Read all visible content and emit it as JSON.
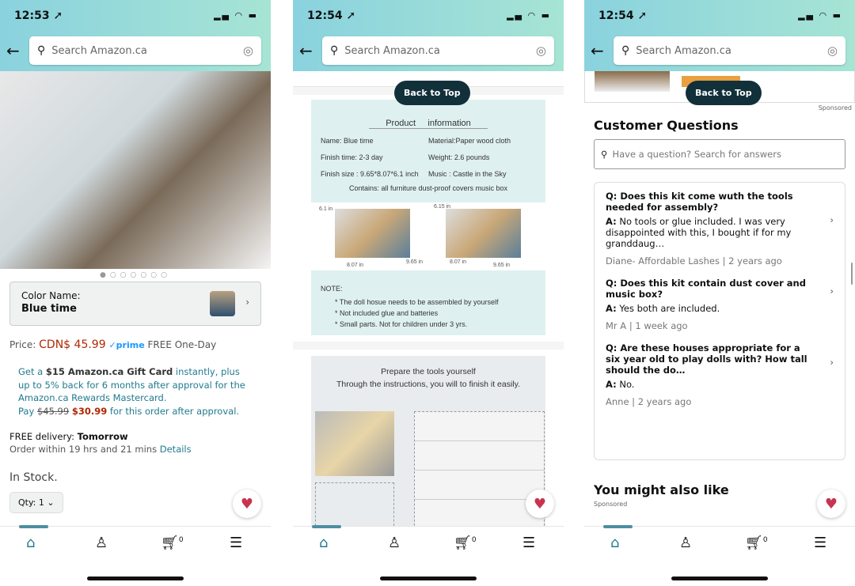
{
  "screens": [
    {
      "time": "12:53 ➚",
      "search_placeholder": "Search Amazon.ca"
    },
    {
      "time": "12:54 ➚",
      "search_placeholder": "Search Amazon.ca"
    },
    {
      "time": "12:54 ➚",
      "search_placeholder": "Search Amazon.ca"
    }
  ],
  "product": {
    "color_label": "Color Name:",
    "color_value": "Blue time",
    "price_label": "Price:",
    "price": "CDN$ 45.99",
    "prime": "✓prime",
    "shipping": "FREE One-Day",
    "offer": {
      "a": "Get a ",
      "b": "$15 Amazon.ca Gift Card",
      "c": " instantly, plus up to 5% back for 6 months after approval for the Amazon.ca Rewards Mastercard.",
      "pay": "Pay ",
      "old": "$45.99",
      "new": "$30.99",
      "tail": " for this order after approval."
    },
    "delivery_label": "FREE delivery: ",
    "delivery_day": "Tomorrow",
    "order_within": "Order within 19 hrs and 21 mins ",
    "details": "Details",
    "stock": "In Stock.",
    "qty": "Qty: 1"
  },
  "back_to_top": "Back to Top",
  "info": {
    "title": "Product     information",
    "rows": [
      [
        "Name: Blue time",
        "Material:Paper  wood  cloth"
      ],
      [
        "Finish time: 2-3 day",
        "Weight: 2.6 pounds"
      ],
      [
        "Finish size : 9.65*8.07*6.1 inch",
        "Music : Castle in the Sky"
      ]
    ],
    "contains": "Contains: all furniture  dust-proof covers  music box",
    "dims": [
      "6.1 in",
      "8.07 in",
      "9.65 in",
      "6.15 in",
      "8.07 in",
      "9.65 in"
    ],
    "note_title": "NOTE:",
    "notes": [
      "*  The doll hosue needs to be assembled by yourself",
      "*  Not included glue and batteries",
      "*  Small parts. Not for children under 3 yrs."
    ],
    "tools_title": "Prepare the tools yourself",
    "tools_sub": "Through the instructions, you will to finish it easily."
  },
  "sponsored": "Sponsored",
  "questions": {
    "heading": "Customer Questions",
    "placeholder": "Have a question? Search for answers",
    "items": [
      {
        "q": "Q: Does this kit come wuth the tools needed for assembly?",
        "a_label": "A:",
        "a": " No tools or glue included. I was very disappointed with this, I bought if for my granddaug…",
        "meta": "Diane- Affordable Lashes |  2 years ago"
      },
      {
        "q": "Q: Does this kit contain dust cover and music box?",
        "a_label": "A:",
        "a": " Yes both are included.",
        "meta": "Mr A |  1 week ago"
      },
      {
        "q": "Q: Are these houses appropriate for a six year old to play dolls with? How tall should the do…",
        "a_label": "A:",
        "a": " No.",
        "meta": "Anne |  2 years ago"
      }
    ]
  },
  "also_like": "You might also like",
  "nav": {
    "cart_count": "0"
  },
  "colors": {
    "accent": "#217b8f",
    "price": "#b12704",
    "heart": "#c7344f",
    "button": "#12303a"
  }
}
